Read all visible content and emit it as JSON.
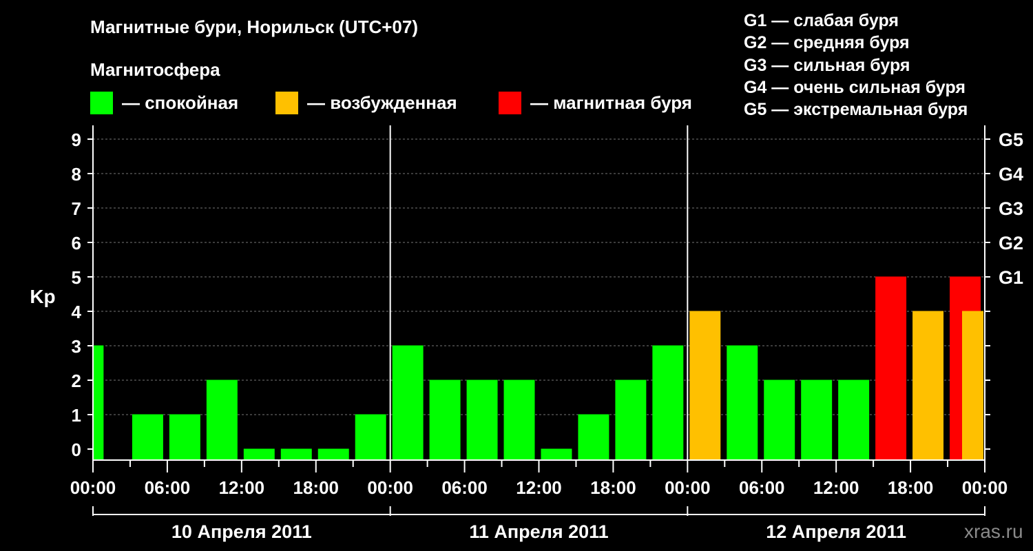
{
  "header": {
    "title": "Магнитные бури, Норильск (UTC+07)",
    "subtitle": "Магнитосфера"
  },
  "legend": [
    {
      "label": "— спокойная",
      "color": "#00ff00"
    },
    {
      "label": "— возбужденная",
      "color": "#ffc000"
    },
    {
      "label": "— магнитная буря",
      "color": "#ff0000"
    }
  ],
  "g_legend": [
    "G1 — слабая буря",
    "G2 — средняя буря",
    "G3 — сильная буря",
    "G4 — очень сильная буря",
    "G5 — экстремальная буря"
  ],
  "watermark": "xras.ru",
  "chart_data": {
    "type": "bar",
    "ylabel": "Kp",
    "ylim": [
      0,
      9
    ],
    "y_ticks": [
      0,
      1,
      2,
      3,
      4,
      5,
      6,
      7,
      8,
      9
    ],
    "right_axis_ticks": [
      {
        "value": 5,
        "label": "G1"
      },
      {
        "value": 6,
        "label": "G2"
      },
      {
        "value": 7,
        "label": "G3"
      },
      {
        "value": 8,
        "label": "G4"
      },
      {
        "value": 9,
        "label": "G5"
      }
    ],
    "x_tick_labels": [
      "00:00",
      "06:00",
      "12:00",
      "18:00",
      "00:00",
      "06:00",
      "12:00",
      "18:00",
      "00:00",
      "06:00",
      "12:00",
      "18:00",
      "00:00"
    ],
    "x_minor_step_hours": 3,
    "x_range_hours": [
      0,
      72
    ],
    "day_labels": [
      "10 Апреля 2011",
      "11 Апреля 2011",
      "12 Апреля 2011"
    ],
    "grid": true,
    "colors": {
      "quiet": "#00ff00",
      "active": "#ffc000",
      "storm": "#ff0000"
    },
    "bars": [
      {
        "start": 0,
        "end": 0.8,
        "value": 3,
        "level": "quiet"
      },
      {
        "start": 3,
        "value": 1,
        "level": "quiet"
      },
      {
        "start": 6,
        "value": 1,
        "level": "quiet"
      },
      {
        "start": 9,
        "value": 2,
        "level": "quiet"
      },
      {
        "start": 12,
        "value": 0,
        "level": "quiet"
      },
      {
        "start": 15,
        "value": 0,
        "level": "quiet"
      },
      {
        "start": 18,
        "value": 0,
        "level": "quiet"
      },
      {
        "start": 21,
        "value": 1,
        "level": "quiet"
      },
      {
        "start": 24,
        "value": 3,
        "level": "quiet"
      },
      {
        "start": 27,
        "value": 2,
        "level": "quiet"
      },
      {
        "start": 30,
        "value": 2,
        "level": "quiet"
      },
      {
        "start": 33,
        "value": 2,
        "level": "quiet"
      },
      {
        "start": 36,
        "value": 0,
        "level": "quiet"
      },
      {
        "start": 39,
        "value": 1,
        "level": "quiet"
      },
      {
        "start": 42,
        "value": 2,
        "level": "quiet"
      },
      {
        "start": 45,
        "value": 3,
        "level": "quiet"
      },
      {
        "start": 48,
        "value": 4,
        "level": "active"
      },
      {
        "start": 51,
        "value": 3,
        "level": "quiet"
      },
      {
        "start": 54,
        "value": 2,
        "level": "quiet"
      },
      {
        "start": 57,
        "value": 2,
        "level": "quiet"
      },
      {
        "start": 60,
        "value": 2,
        "level": "quiet"
      },
      {
        "start": 63,
        "value": 5,
        "level": "storm"
      },
      {
        "start": 66,
        "value": 4,
        "level": "active"
      },
      {
        "start": 69,
        "value": 5,
        "level": "storm"
      },
      {
        "start": 72,
        "value": 4,
        "level": "active"
      }
    ]
  }
}
